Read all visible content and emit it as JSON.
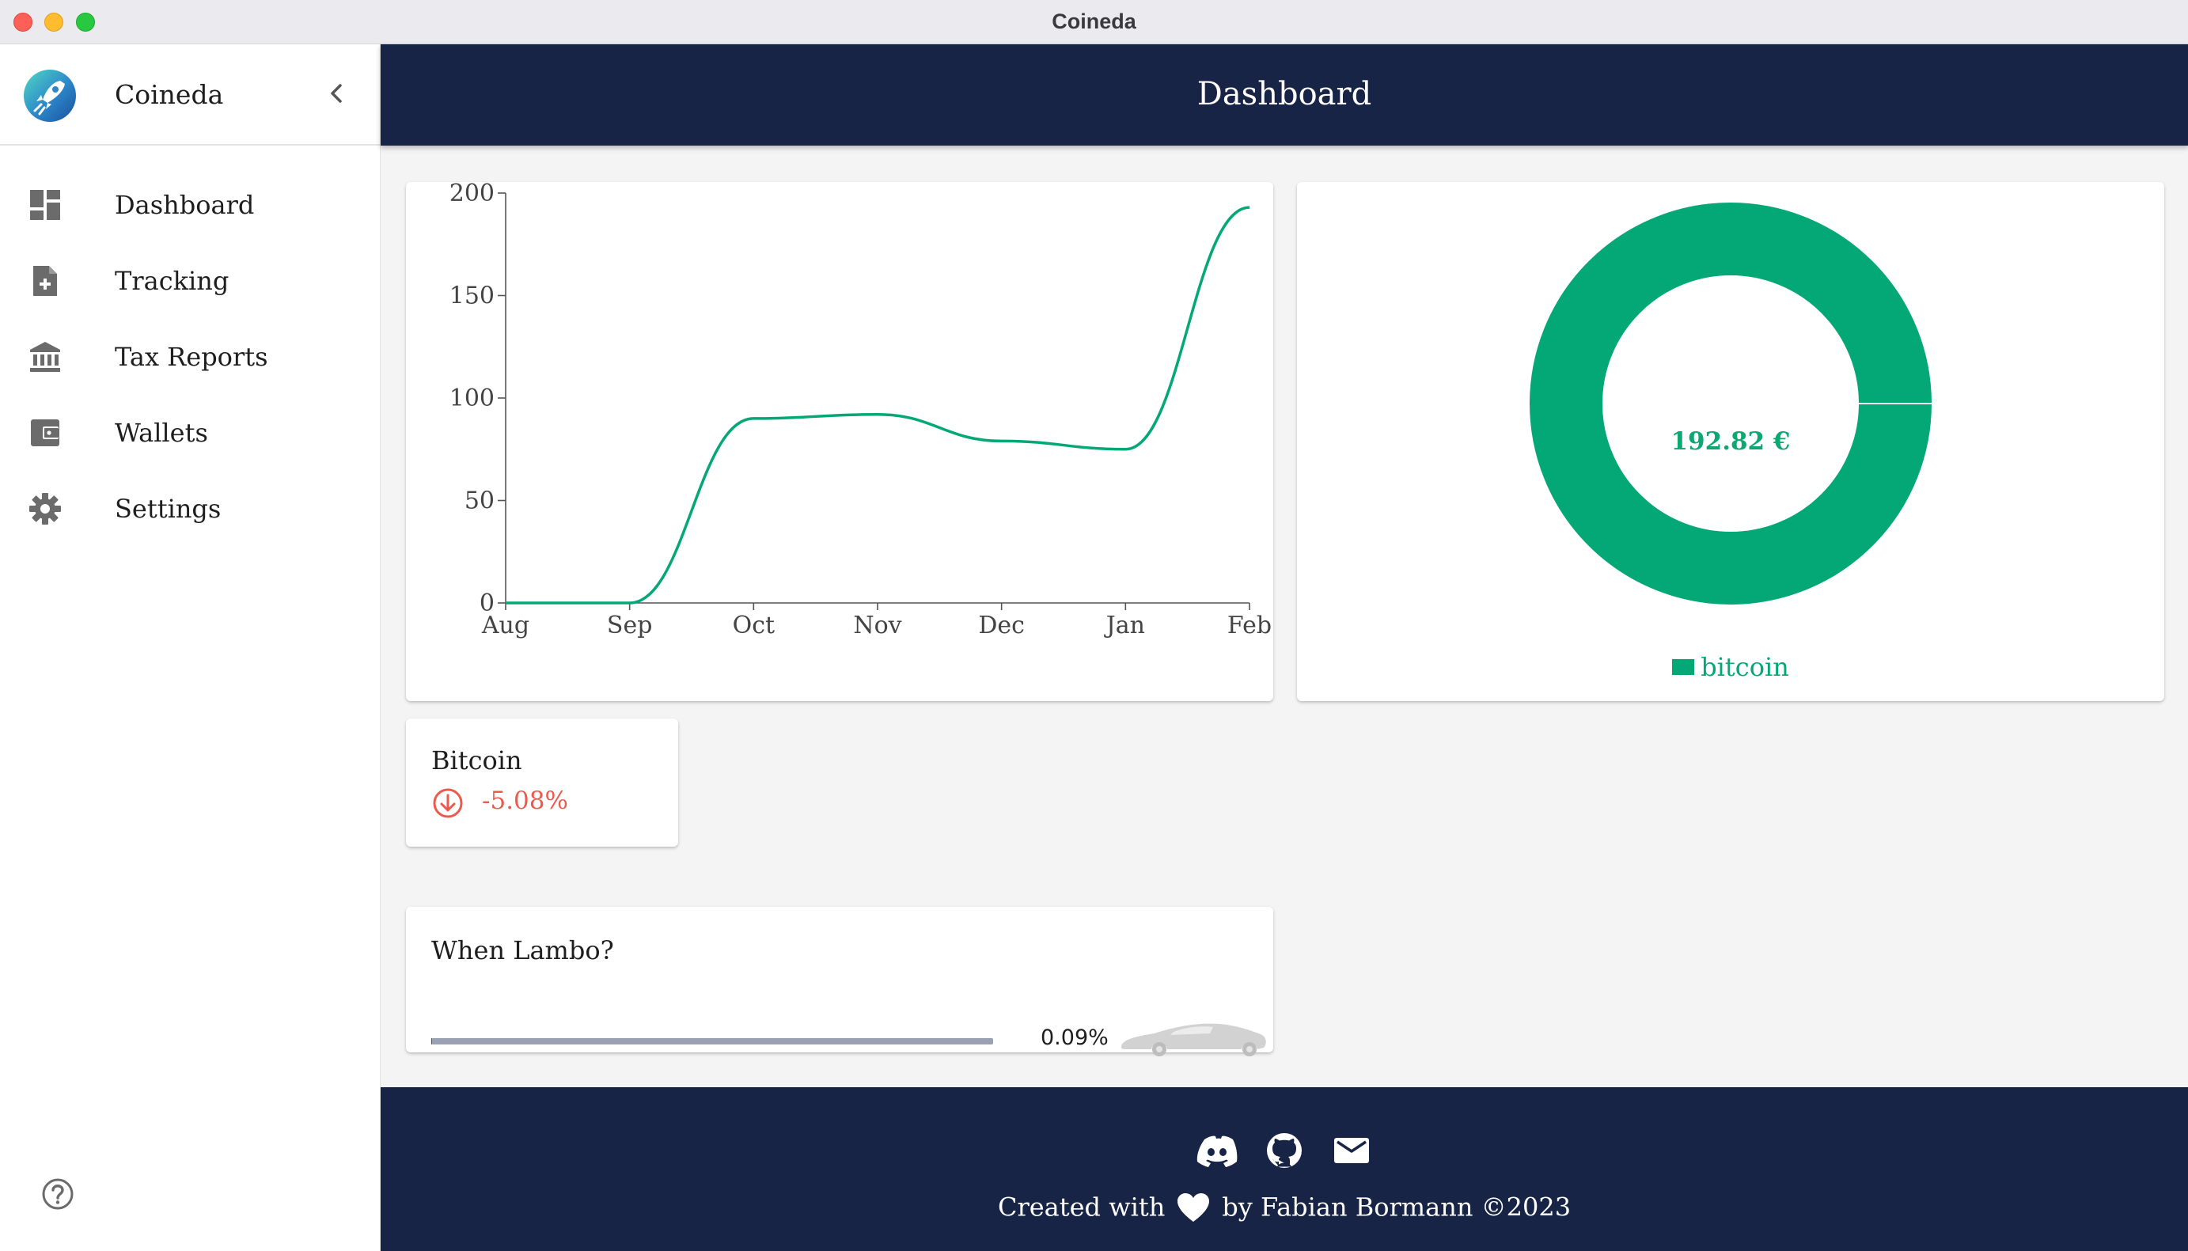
{
  "window": {
    "title": "Coineda"
  },
  "sidebar": {
    "brand": "Coineda",
    "items": [
      {
        "label": "Dashboard",
        "icon": "dashboard-icon"
      },
      {
        "label": "Tracking",
        "icon": "add-document-icon"
      },
      {
        "label": "Tax Reports",
        "icon": "bank-icon"
      },
      {
        "label": "Wallets",
        "icon": "wallet-icon"
      },
      {
        "label": "Settings",
        "icon": "gear-icon"
      }
    ]
  },
  "header": {
    "title": "Dashboard"
  },
  "colors": {
    "accent": "#04a877",
    "navy": "#172446",
    "negative": "#ec5a4e"
  },
  "chart_data": [
    {
      "type": "line",
      "x": [
        "Aug",
        "Sep",
        "Oct",
        "Nov",
        "Dec",
        "Jan",
        "Feb"
      ],
      "series": [
        {
          "values": [
            0,
            0,
            90,
            92,
            79,
            75,
            193
          ]
        }
      ],
      "yticks": [
        0,
        50,
        100,
        150,
        200
      ],
      "ylim": [
        0,
        200
      ],
      "grid": false
    },
    {
      "type": "pie",
      "variant": "donut",
      "categories": [
        "bitcoin"
      ],
      "values": [
        192.82
      ],
      "center_label": "192.82 €",
      "legend": "bottom"
    }
  ],
  "coin": {
    "name": "Bitcoin",
    "change": "-5.08%",
    "direction": "down"
  },
  "lambo": {
    "title": "When Lambo?",
    "progress_label": "0.09%",
    "progress_fraction": 0.0009
  },
  "footer": {
    "icons": [
      "discord-icon",
      "github-icon",
      "mail-icon"
    ],
    "credit_prefix": "Created with",
    "credit_suffix": "by Fabian Bormann ©2023"
  }
}
